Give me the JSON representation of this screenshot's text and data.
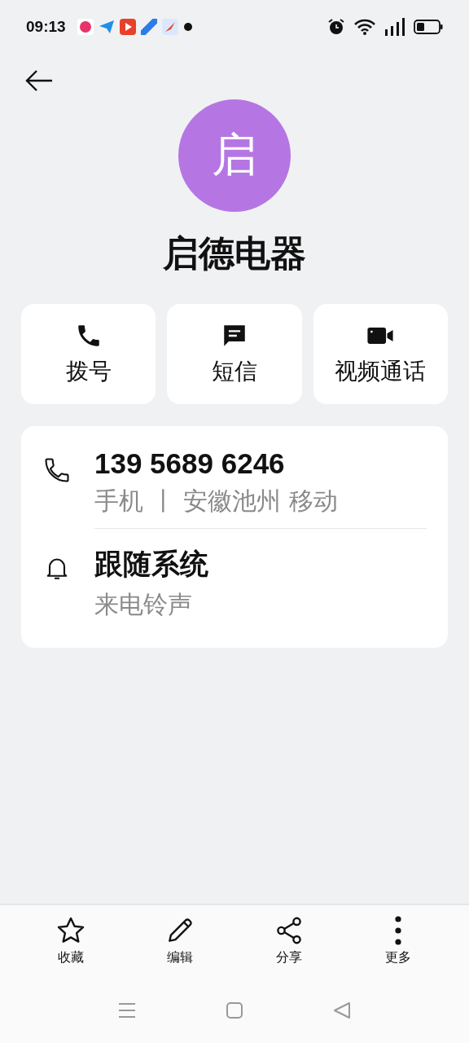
{
  "status_bar": {
    "time": "09:13"
  },
  "contact": {
    "avatar_letter": "启",
    "name": "启德电器"
  },
  "actions": [
    {
      "kind": "call",
      "label": "拨号"
    },
    {
      "kind": "message",
      "label": "短信"
    },
    {
      "kind": "video",
      "label": "视频通话"
    }
  ],
  "info": [
    {
      "kind": "phone",
      "title": "139 5689 6246",
      "subtitle": "手机 丨 安徽池州 移动"
    },
    {
      "kind": "bell",
      "title": "跟随系统",
      "subtitle": "来电铃声"
    }
  ],
  "bottom_bar": [
    {
      "kind": "star",
      "label": "收藏"
    },
    {
      "kind": "edit",
      "label": "编辑"
    },
    {
      "kind": "share",
      "label": "分享"
    },
    {
      "kind": "more",
      "label": "更多"
    }
  ]
}
